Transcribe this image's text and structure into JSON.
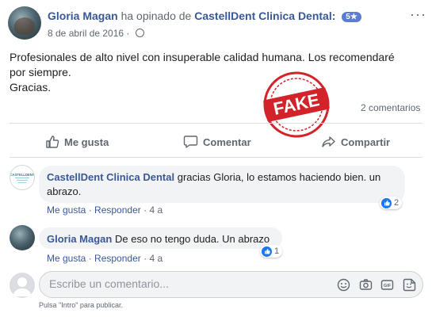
{
  "post": {
    "author": "Gloria Magan",
    "action_text": "ha opinado de",
    "page": "CastellDent Clinica Dental:",
    "rating": "5★",
    "date": "8 de abril de 2016 ·",
    "lines": [
      "Profesionales de alto nivel con insuperable calidad humana. Los recomendaré",
      "por siempre.",
      "Gracias."
    ],
    "stamp_text": "FAKE",
    "comments_count": "2 comentarios",
    "more_label": "···"
  },
  "actions": {
    "like": "Me gusta",
    "comment": "Comentar",
    "share": "Compartir"
  },
  "comments": [
    {
      "author": "CastellDent Clinica Dental",
      "text_line1": "gracias Gloria, lo estamos haciendo bien. un",
      "text_line2": "abrazo.",
      "like": "Me gusta",
      "sep": "·",
      "reply": "Responder",
      "age": "4 a",
      "reactions": "2"
    },
    {
      "author": "Gloria Magan",
      "text_line1": "De eso no tengo duda. Un abrazo",
      "like": "Me gusta",
      "sep": "·",
      "reply": "Responder",
      "age": "4 a",
      "reactions": "1"
    }
  ],
  "composer": {
    "placeholder": "Escribe un comentario...",
    "hint": "Pulsa \"Intro\" para publicar.",
    "gif_label": "GIF"
  },
  "colors": {
    "link": "#385898",
    "accent": "#1877f2",
    "stamp": "#d2232a",
    "badge": "#5b7bd5"
  }
}
